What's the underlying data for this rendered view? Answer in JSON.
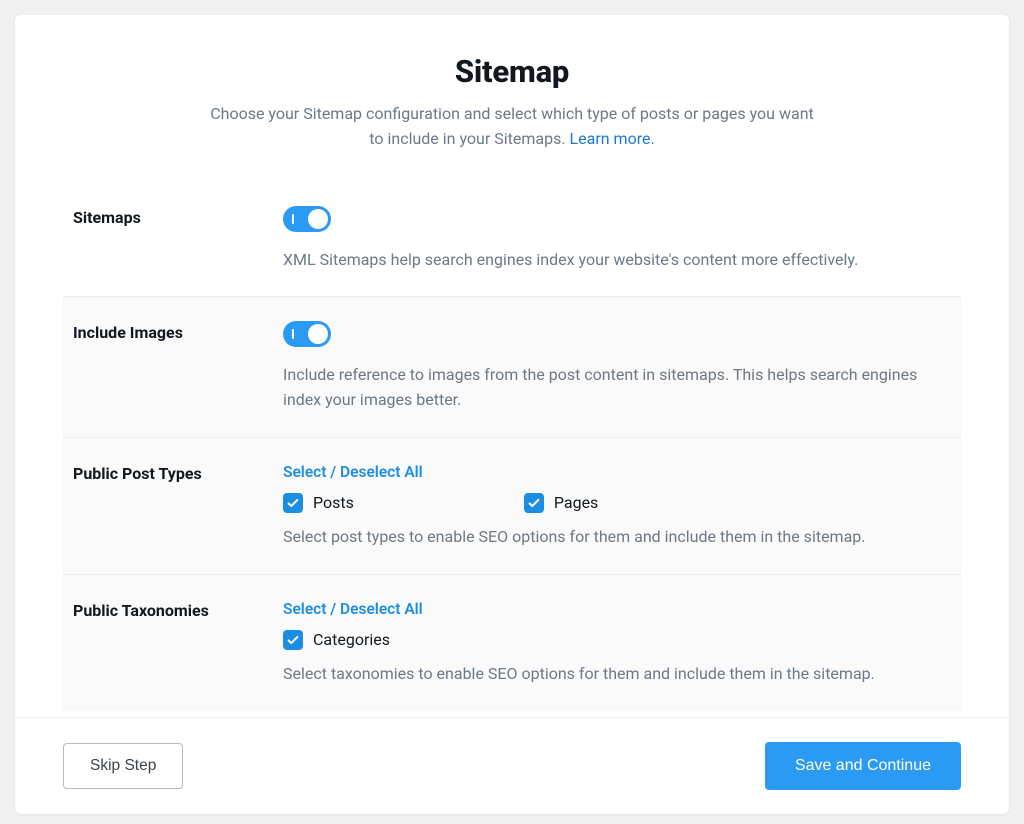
{
  "header": {
    "title": "Sitemap",
    "subtitle_a": "Choose your Sitemap configuration and select which type of posts or pages you want",
    "subtitle_b": "to include in your Sitemaps.",
    "learn_more": "Learn more."
  },
  "rows": {
    "sitemaps": {
      "label": "Sitemaps",
      "help": "XML Sitemaps help search engines index your website's content more effectively.",
      "enabled": true
    },
    "images": {
      "label": "Include Images",
      "help": "Include reference to images from the post content in sitemaps. This helps search engines index your images better.",
      "enabled": true
    },
    "post_types": {
      "label": "Public Post Types",
      "select_all": "Select / Deselect All",
      "options": [
        {
          "label": "Posts",
          "checked": true
        },
        {
          "label": "Pages",
          "checked": true
        }
      ],
      "help": "Select post types to enable SEO options for them and include them in the sitemap."
    },
    "taxonomies": {
      "label": "Public Taxonomies",
      "select_all": "Select / Deselect All",
      "options": [
        {
          "label": "Categories",
          "checked": true
        }
      ],
      "help": "Select taxonomies to enable SEO options for them and include them in the sitemap."
    }
  },
  "footer": {
    "skip": "Skip Step",
    "save": "Save and Continue"
  }
}
